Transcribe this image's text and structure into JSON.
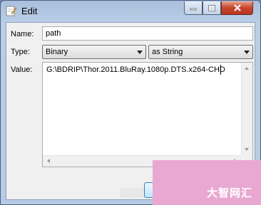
{
  "window": {
    "title": "Edit"
  },
  "titlebar": {
    "minimize_icon": "minimize-icon",
    "maximize_icon": "maximize-icon",
    "close_icon": "close-icon"
  },
  "form": {
    "name_label": "Name:",
    "name_value": "path",
    "type_label": "Type:",
    "type_value": "Binary",
    "format_value": "as String",
    "value_label": "Value:",
    "value_text": "G:\\BDRIP\\Thor.2011.BluRay.1080p.DTS.x264-CHD"
  },
  "watermark": {
    "text": "大智网汇"
  },
  "colors": {
    "accent": "#b9cde6",
    "close_red": "#c7452b",
    "watermark_pink": "#e9a8d2"
  }
}
